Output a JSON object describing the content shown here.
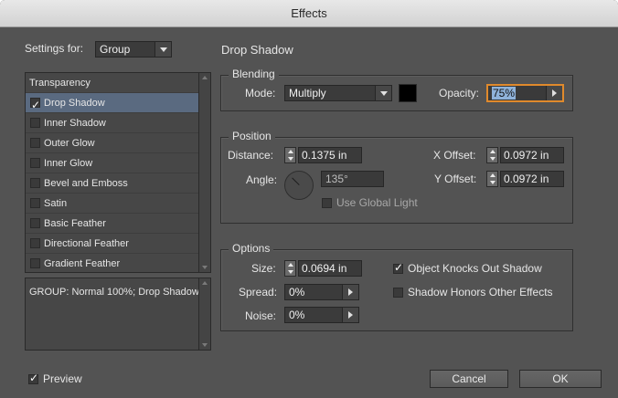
{
  "window": {
    "title": "Effects"
  },
  "settings_for": {
    "label": "Settings for:",
    "value": "Group"
  },
  "effects_list": {
    "header": "Transparency",
    "items": [
      {
        "label": "Drop Shadow",
        "checked": true,
        "selected": true
      },
      {
        "label": "Inner Shadow",
        "checked": false
      },
      {
        "label": "Outer Glow",
        "checked": false
      },
      {
        "label": "Inner Glow",
        "checked": false
      },
      {
        "label": "Bevel and Emboss",
        "checked": false
      },
      {
        "label": "Satin",
        "checked": false
      },
      {
        "label": "Basic Feather",
        "checked": false
      },
      {
        "label": "Directional Feather",
        "checked": false
      },
      {
        "label": "Gradient Feather",
        "checked": false
      }
    ]
  },
  "summary": "GROUP: Normal 100%; Drop Shadow",
  "panel_title": "Drop Shadow",
  "blending": {
    "title": "Blending",
    "mode_label": "Mode:",
    "mode_value": "Multiply",
    "swatch_color": "#000000",
    "opacity_label": "Opacity:",
    "opacity_value": "75%"
  },
  "position": {
    "title": "Position",
    "distance_label": "Distance:",
    "distance_value": "0.1375 in",
    "angle_label": "Angle:",
    "angle_value": "135°",
    "use_global_light": "Use Global Light",
    "x_offset_label": "X Offset:",
    "x_offset_value": "0.0972 in",
    "y_offset_label": "Y Offset:",
    "y_offset_value": "0.0972 in"
  },
  "options": {
    "title": "Options",
    "size_label": "Size:",
    "size_value": "0.0694 in",
    "spread_label": "Spread:",
    "spread_value": "0%",
    "noise_label": "Noise:",
    "noise_value": "0%",
    "knocks_out": "Object Knocks Out Shadow",
    "knocks_out_checked": true,
    "honors_effects": "Shadow Honors Other Effects",
    "honors_effects_checked": false
  },
  "footer": {
    "preview_label": "Preview",
    "preview_checked": true,
    "cancel_label": "Cancel",
    "ok_label": "OK"
  },
  "colors": {
    "dialog_bg": "#535353",
    "selection": "#5a6a80",
    "focus_ring": "#e08a2c"
  }
}
